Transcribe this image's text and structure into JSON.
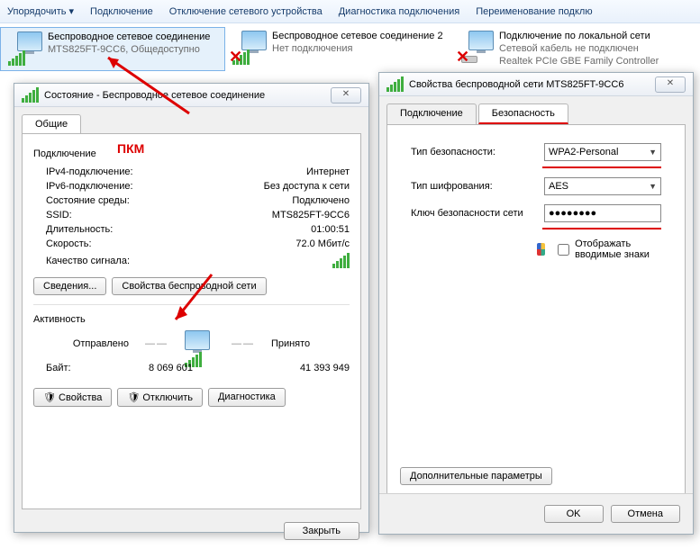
{
  "toolbar": {
    "items": [
      "Упорядочить ▾",
      "Подключение",
      "Отключение сетевого устройства",
      "Диагностика подключения",
      "Переименование подклю"
    ]
  },
  "netItems": [
    {
      "title": "Беспроводное сетевое соединение",
      "sub": "MTS825FT-9CC6, Общедоступно",
      "selected": true,
      "disabled": false,
      "type": "wifi"
    },
    {
      "title": "Беспроводное сетевое соединение 2",
      "sub": "Нет подключения",
      "selected": false,
      "disabled": true,
      "type": "wifi"
    },
    {
      "title": "Подключение по локальной сети",
      "sub": "Сетевой кабель не подключен",
      "sub2": "Realtek PCIe GBE Family Controller",
      "selected": false,
      "disabled": true,
      "type": "lan"
    }
  ],
  "status": {
    "title": "Состояние - Беспроводное сетевое соединение",
    "tab": "Общие",
    "rmb": "ПКМ",
    "groupConn": "Подключение",
    "rows": {
      "ipv4": {
        "k": "IPv4-подключение:",
        "v": "Интернет"
      },
      "ipv6": {
        "k": "IPv6-подключение:",
        "v": "Без доступа к сети"
      },
      "media": {
        "k": "Состояние среды:",
        "v": "Подключено"
      },
      "ssid": {
        "k": "SSID:",
        "v": "MTS825FT-9CC6"
      },
      "duration": {
        "k": "Длительность:",
        "v": "01:00:51"
      },
      "speed": {
        "k": "Скорость:",
        "v": "72.0 Мбит/с"
      },
      "signal": {
        "k": "Качество сигнала:"
      }
    },
    "btnDetails": "Сведения...",
    "btnWifiProps": "Свойства беспроводной сети",
    "groupActivity": "Активность",
    "sent": "Отправлено",
    "received": "Принято",
    "bytesLabel": "Байт:",
    "bytesSent": "8 069 601",
    "bytesRecv": "41 393 949",
    "btnProps": "Свойства",
    "btnDisable": "Отключить",
    "btnDiag": "Диагностика",
    "btnClose": "Закрыть"
  },
  "props": {
    "title": "Свойства беспроводной сети MTS825FT-9CC6",
    "tabs": {
      "conn": "Подключение",
      "sec": "Безопасность"
    },
    "fields": {
      "secType": {
        "label": "Тип безопасности:",
        "value": "WPA2-Personal"
      },
      "enc": {
        "label": "Тип шифрования:",
        "value": "AES"
      },
      "key": {
        "label": "Ключ безопасности сети",
        "value": "●●●●●●●●"
      },
      "showChars": "Отображать вводимые знаки"
    },
    "btnAdv": "Дополнительные параметры",
    "btnOk": "OK",
    "btnCancel": "Отмена"
  }
}
